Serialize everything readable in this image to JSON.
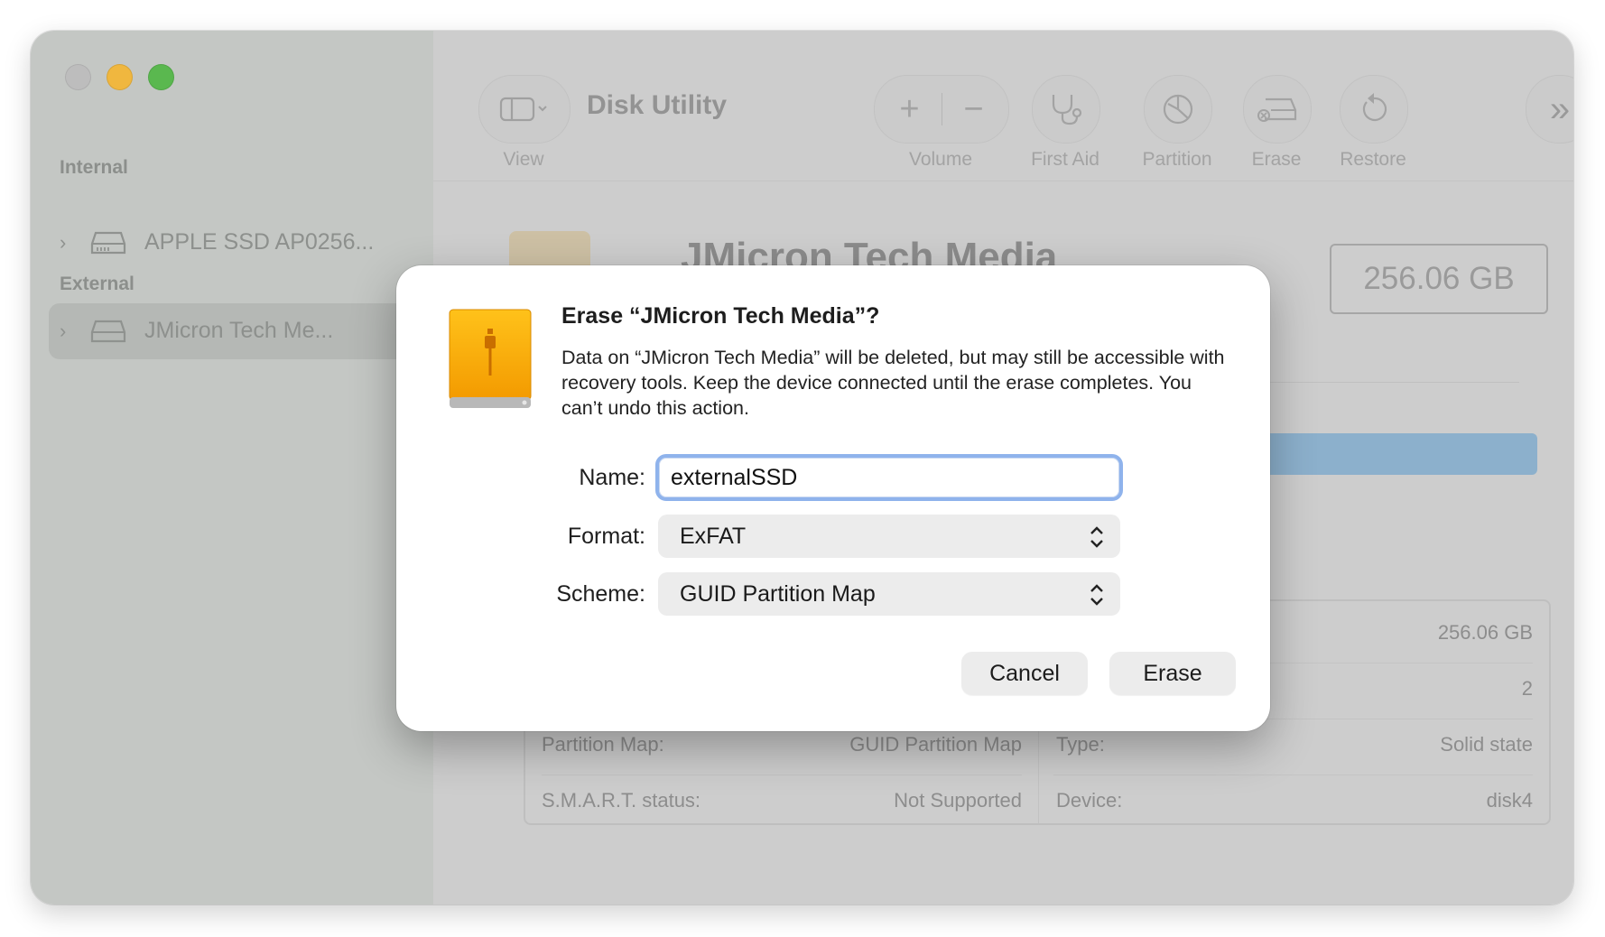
{
  "window": {
    "app_title": "Disk Utility"
  },
  "sidebar": {
    "sections": [
      {
        "label": "Internal",
        "items": [
          {
            "label": "APPLE SSD AP0256..."
          }
        ]
      },
      {
        "label": "External",
        "items": [
          {
            "label": "JMicron Tech Me..."
          }
        ]
      }
    ]
  },
  "toolbar": {
    "view_label": "View",
    "volume_label": "Volume",
    "first_aid_label": "First Aid",
    "partition_label": "Partition",
    "erase_label": "Erase",
    "restore_label": "Restore",
    "add_symbol": "+",
    "remove_symbol": "−",
    "more_symbol": "»"
  },
  "detail": {
    "disk_title": "JMicron Tech Media",
    "capacity": "256.06 GB",
    "info_rows": [
      {
        "left_label": "",
        "left_value": "",
        "right_label": "",
        "right_value": "256.06 GB"
      },
      {
        "left_label": "",
        "left_value": "",
        "right_label": "",
        "right_value": "2"
      },
      {
        "left_label": "Partition Map:",
        "left_value": "GUID Partition Map",
        "right_label": "Type:",
        "right_value": "Solid state"
      },
      {
        "left_label": "S.M.A.R.T. status:",
        "left_value": "Not Supported",
        "right_label": "Device:",
        "right_value": "disk4"
      }
    ]
  },
  "dialog": {
    "title": "Erase “JMicron Tech Media”?",
    "message": "Data on “JMicron Tech Media” will be deleted, but may still be accessible with recovery tools. Keep the device connected until the erase completes. You can’t undo this action.",
    "name_label": "Name:",
    "name_value": "externalSSD",
    "format_label": "Format:",
    "format_value": "ExFAT",
    "scheme_label": "Scheme:",
    "scheme_value": "GUID Partition Map",
    "cancel_label": "Cancel",
    "erase_label": "Erase"
  },
  "colors": {
    "drive_icon": "#f5a800",
    "focus_ring": "#8fb3ec",
    "close": "#bdbdbd",
    "minimize": "#f0b73f",
    "maximize": "#5ab84f"
  }
}
